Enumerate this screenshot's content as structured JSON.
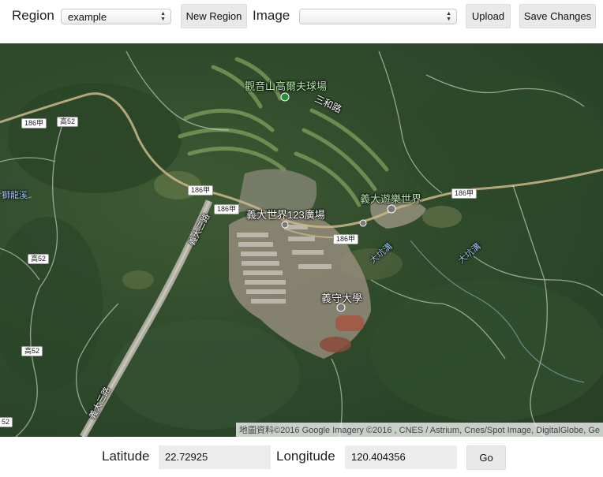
{
  "toolbar": {
    "region_label": "Region",
    "region_value": "example",
    "new_region_button": "New Region",
    "image_label": "Image",
    "image_value": "",
    "upload_button": "Upload",
    "save_button": "Save Changes"
  },
  "map": {
    "places": {
      "golf_course": "觀音山高爾夫球場",
      "sanhe_road": "三和路",
      "e_world_plaza": "義大世界123廣場",
      "e_da_theme_park": "義大遊樂世界",
      "isu": "義守大學",
      "shilong_stream": "獅龍溪",
      "dakeng_creek_1": "大坑溝",
      "dakeng_creek_2": "大坑溝",
      "yida_3rd_road_1": "義大三路",
      "yida_3rd_road_2": "義大三路"
    },
    "shields": {
      "r186_1": "186甲",
      "r186_2": "186甲",
      "r186_3": "186甲",
      "r186_4": "186甲",
      "r186_5": "186甲",
      "k52_1": "高52",
      "k52_2": "高52",
      "k52_3": "高52",
      "k52_4": "52"
    },
    "attribution": "地圖資料©2016 Google Imagery ©2016 , CNES / Astrium, Cnes/Spot Image, DigitalGlobe, Ge"
  },
  "location": {
    "latitude_label": "Latitude",
    "latitude_value": "22.72925",
    "longitude_label": "Longitude",
    "longitude_value": "120.404356",
    "go_button": "Go"
  }
}
